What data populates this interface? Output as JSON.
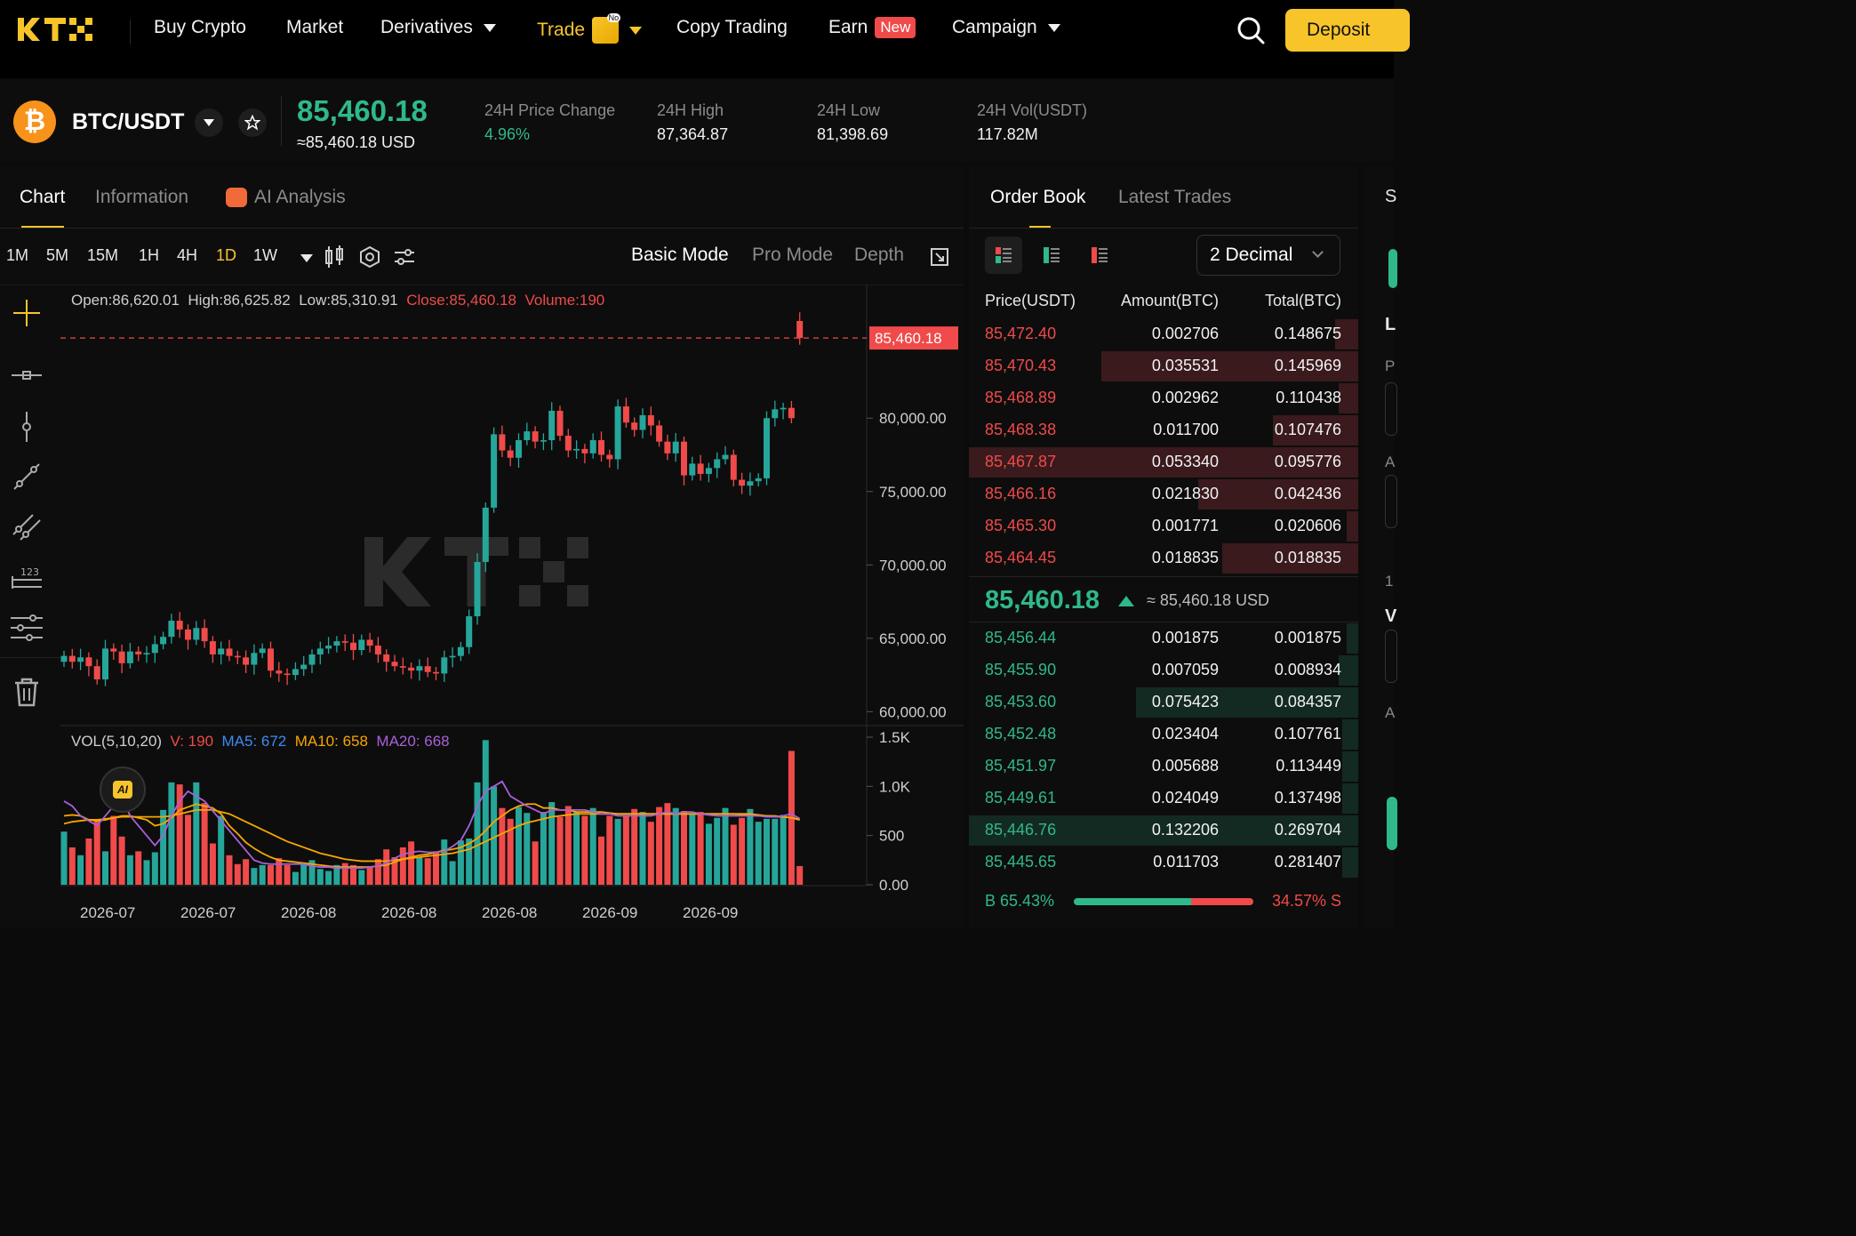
{
  "nav": {
    "logo": "KTX",
    "items": [
      {
        "label": "Buy Crypto",
        "x": 173
      },
      {
        "label": "Market",
        "x": 322
      },
      {
        "label": "Derivatives",
        "x": 428,
        "caret": true
      },
      {
        "label": "Trade",
        "x": 604,
        "caret": true,
        "active": true,
        "icon": true
      },
      {
        "label": "Copy Trading",
        "x": 761
      },
      {
        "label": "Earn",
        "x": 932,
        "badge": "New"
      },
      {
        "label": "Campaign",
        "x": 1071,
        "caret": true
      }
    ],
    "trade_icon_badge": "No",
    "deposit_label": "Deposit"
  },
  "ticker": {
    "pair": "BTC/USDT",
    "coin_symbol": "₿",
    "price": "85,460.18",
    "price_usd": "≈85,460.18 USD",
    "stats": [
      {
        "label": "24H Price Change",
        "value": "4.96%",
        "positive": true
      },
      {
        "label": "24H High",
        "value": "87,364.87"
      },
      {
        "label": "24H Low",
        "value": "81,398.69"
      },
      {
        "label": "24H Vol(USDT)",
        "value": "117.82M"
      }
    ]
  },
  "chart_tabs": [
    "Chart",
    "Information",
    "AI Analysis"
  ],
  "timeframes": [
    "1M",
    "5M",
    "15M",
    "1H",
    "4H",
    "1D",
    "1W"
  ],
  "active_timeframe": "1D",
  "modes": [
    "Basic Mode",
    "Pro Mode",
    "Depth"
  ],
  "ohlc": {
    "open": "Open:86,620.01",
    "high": "High:86,625.82",
    "low": "Low:85,310.91",
    "close": "Close:85,460.18",
    "volume": "Volume:190"
  },
  "vol_legend": {
    "title": "VOL(5,10,20)",
    "v": "V: 190",
    "ma5": "MA5: 672",
    "ma10": "MA10: 658",
    "ma20": "MA20: 668"
  },
  "colors": {
    "up": "#26a69a",
    "down": "#f04a4a",
    "ma5": "#a960d8",
    "ma10": "#f7a600",
    "ma20": "#f7a600",
    "accent": "#f7c52a"
  },
  "chart_data": {
    "type": "candlestick",
    "price_axis": {
      "ticks": [
        "80,000.00",
        "75,000.00",
        "70,000.00",
        "65,000.00",
        "60,000.00"
      ],
      "ylim": [
        59900,
        86800
      ]
    },
    "current_price_label": "85,460.18",
    "current_price": 85460.18,
    "volume_axis": {
      "ticks": [
        "1.5K",
        "1.0K",
        "500",
        "0.00"
      ],
      "ylim": [
        0,
        1500
      ]
    },
    "x_ticks": [
      "2026-07",
      "2026-07",
      "2026-08",
      "2026-08",
      "2026-08",
      "2026-09",
      "2026-09"
    ],
    "closes": [
      63800,
      63400,
      63700,
      63100,
      62200,
      64300,
      64100,
      63300,
      64100,
      63900,
      64000,
      64600,
      65100,
      66200,
      65600,
      64900,
      65700,
      64800,
      63900,
      64300,
      63800,
      63700,
      63200,
      64000,
      64300,
      62800,
      62600,
      62500,
      62900,
      63200,
      63900,
      64300,
      64500,
      64800,
      64700,
      64200,
      64900,
      64500,
      63900,
      63400,
      63100,
      63000,
      62800,
      63100,
      62700,
      62600,
      63700,
      63800,
      64400,
      66500,
      70200,
      73900,
      78900,
      77800,
      77300,
      78500,
      79100,
      78400,
      78500,
      80500,
      78800,
      77800,
      77900,
      77600,
      78500,
      77500,
      77200,
      80800,
      79700,
      79200,
      80200,
      79500,
      78400,
      77600,
      78400,
      76100,
      76900,
      76200,
      76600,
      77200,
      77500,
      75800,
      75400,
      75700,
      75900,
      80000,
      80600,
      80700,
      80000,
      85460
    ],
    "opens": [
      63400,
      63800,
      63400,
      63700,
      63100,
      62200,
      64300,
      64100,
      63300,
      64100,
      63900,
      64000,
      64600,
      65100,
      66200,
      65600,
      64900,
      65700,
      64800,
      63900,
      64300,
      63800,
      63700,
      63200,
      64000,
      64300,
      62800,
      62600,
      62500,
      62900,
      63200,
      63900,
      64300,
      64500,
      64800,
      64700,
      64200,
      64900,
      64500,
      63900,
      63400,
      63100,
      63000,
      62800,
      63100,
      62700,
      62600,
      63700,
      63800,
      64400,
      66500,
      70200,
      73900,
      78900,
      77800,
      77300,
      78500,
      79100,
      78400,
      78500,
      80500,
      78800,
      77800,
      77900,
      77600,
      78500,
      77500,
      77200,
      80800,
      79700,
      79200,
      80200,
      79500,
      78400,
      77600,
      78400,
      76100,
      76900,
      76200,
      76600,
      77200,
      77500,
      75800,
      75400,
      75700,
      75900,
      80000,
      80600,
      80700,
      86620
    ],
    "volumes": [
      540,
      380,
      300,
      470,
      660,
      340,
      700,
      490,
      300,
      340,
      250,
      330,
      760,
      1040,
      1020,
      710,
      1040,
      830,
      420,
      700,
      300,
      210,
      260,
      170,
      200,
      200,
      270,
      200,
      130,
      220,
      250,
      160,
      140,
      200,
      220,
      200,
      150,
      190,
      260,
      360,
      280,
      380,
      440,
      280,
      270,
      340,
      460,
      240,
      450,
      470,
      1040,
      1470,
      1000,
      780,
      670,
      790,
      730,
      440,
      740,
      840,
      690,
      800,
      740,
      700,
      780,
      490,
      700,
      670,
      700,
      770,
      740,
      640,
      790,
      830,
      780,
      750,
      720,
      740,
      620,
      680,
      780,
      610,
      680,
      770,
      640,
      670,
      670,
      710,
      1360,
      190
    ],
    "ma5": [
      850,
      800,
      700,
      650,
      600,
      700,
      800,
      900,
      700,
      600,
      500,
      400,
      500,
      700,
      850,
      950,
      900,
      850,
      750,
      650,
      550,
      450,
      350,
      250,
      220,
      210,
      210,
      210,
      210,
      210,
      190,
      180,
      180,
      170,
      170,
      170,
      170,
      180,
      190,
      220,
      270,
      310,
      330,
      340,
      330,
      330,
      340,
      390,
      450,
      600,
      800,
      950,
      1000,
      1050,
      900,
      850,
      800,
      760,
      720,
      760,
      760,
      760,
      760,
      760,
      740,
      720,
      720,
      700,
      700,
      700,
      700,
      700,
      720,
      740,
      720,
      740,
      740,
      720,
      710,
      700,
      700,
      700,
      700,
      700,
      700,
      690,
      690,
      700,
      720,
      672
    ],
    "ma10": [
      700,
      710,
      700,
      660,
      650,
      660,
      680,
      700,
      700,
      680,
      660,
      600,
      620,
      680,
      760,
      790,
      820,
      800,
      780,
      720,
      600,
      520,
      430,
      370,
      320,
      280,
      250,
      240,
      230,
      220,
      210,
      200,
      190,
      180,
      180,
      180,
      180,
      180,
      190,
      200,
      230,
      260,
      280,
      300,
      310,
      330,
      350,
      360,
      380,
      420,
      470,
      550,
      640,
      700,
      760,
      800,
      820,
      820,
      780,
      780,
      760,
      760,
      740,
      740,
      740,
      740,
      730,
      720,
      720,
      720,
      720,
      720,
      720,
      720,
      720,
      720,
      720,
      720,
      720,
      720,
      720,
      720,
      710,
      710,
      700,
      700,
      690,
      690,
      680,
      658
    ],
    "ma20": [
      620,
      640,
      650,
      660,
      660,
      670,
      680,
      690,
      690,
      690,
      690,
      690,
      690,
      700,
      720,
      740,
      760,
      760,
      760,
      740,
      720,
      680,
      640,
      600,
      560,
      520,
      480,
      440,
      410,
      380,
      350,
      320,
      300,
      280,
      260,
      250,
      240,
      240,
      240,
      240,
      250,
      260,
      270,
      280,
      290,
      300,
      310,
      320,
      340,
      360,
      400,
      440,
      480,
      520,
      560,
      600,
      630,
      650,
      670,
      690,
      700,
      710,
      720,
      720,
      720,
      720,
      720,
      720,
      720,
      720,
      720,
      720,
      720,
      720,
      720,
      720,
      720,
      720,
      720,
      720,
      720,
      720,
      720,
      720,
      710,
      700,
      700,
      690,
      680,
      668
    ]
  },
  "order_book": {
    "tabs": [
      "Order Book",
      "Latest Trades"
    ],
    "decimal": "2 Decimal",
    "headers": {
      "price": "Price(USDT)",
      "amount": "Amount(BTC)",
      "total": "Total(BTC)"
    },
    "asks": [
      {
        "price": "85,472.40",
        "amount": "0.002706",
        "total": "0.148675",
        "depth": 0.06
      },
      {
        "price": "85,470.43",
        "amount": "0.035531",
        "total": "0.145969",
        "depth": 0.66
      },
      {
        "price": "85,468.89",
        "amount": "0.002962",
        "total": "0.110438",
        "depth": 0.05
      },
      {
        "price": "85,468.38",
        "amount": "0.011700",
        "total": "0.107476",
        "depth": 0.22
      },
      {
        "price": "85,467.87",
        "amount": "0.053340",
        "total": "0.095776",
        "depth": 1.0
      },
      {
        "price": "85,466.16",
        "amount": "0.021830",
        "total": "0.042436",
        "depth": 0.41
      },
      {
        "price": "85,465.30",
        "amount": "0.001771",
        "total": "0.020606",
        "depth": 0.03
      },
      {
        "price": "85,464.45",
        "amount": "0.018835",
        "total": "0.018835",
        "depth": 0.35
      }
    ],
    "mid_price": "85,460.18",
    "mid_usd": "≈ 85,460.18 USD",
    "bids": [
      {
        "price": "85,456.44",
        "amount": "0.001875",
        "total": "0.001875",
        "depth": 0.03
      },
      {
        "price": "85,455.90",
        "amount": "0.007059",
        "total": "0.008934",
        "depth": 0.05
      },
      {
        "price": "85,453.60",
        "amount": "0.075423",
        "total": "0.084357",
        "depth": 0.57
      },
      {
        "price": "85,452.48",
        "amount": "0.023404",
        "total": "0.107761",
        "depth": 0.04
      },
      {
        "price": "85,451.97",
        "amount": "0.005688",
        "total": "0.113449",
        "depth": 0.04
      },
      {
        "price": "85,449.61",
        "amount": "0.024049",
        "total": "0.137498",
        "depth": 0.04
      },
      {
        "price": "85,446.76",
        "amount": "0.132206",
        "total": "0.269704",
        "depth": 1.0
      },
      {
        "price": "85,445.65",
        "amount": "0.011703",
        "total": "0.281407",
        "depth": 0.04
      }
    ],
    "buy_ratio": "B 65.43%",
    "sell_ratio": "34.57% S",
    "buy_fraction": 0.6543
  },
  "right_edge": [
    "S",
    "L",
    "P",
    "A",
    "1",
    "V",
    "A"
  ]
}
